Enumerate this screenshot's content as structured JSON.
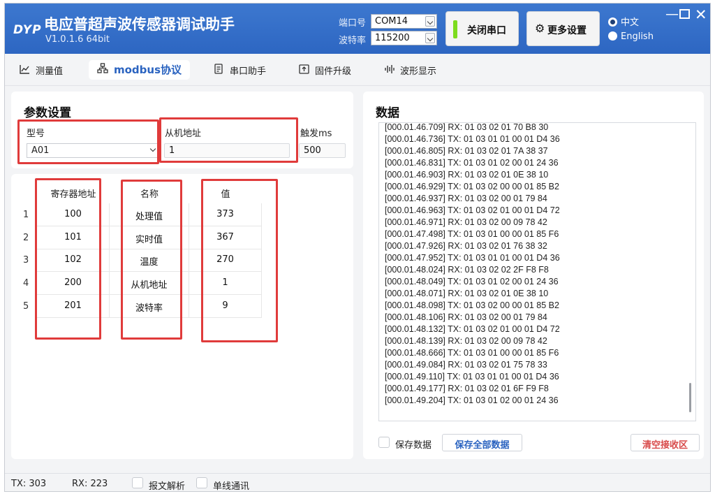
{
  "titlebar": {
    "logo": "DYP",
    "title": "电应普超声波传感器调试助手",
    "version": "V1.0.1.6 64bit",
    "port_label": "端口号",
    "port_value": "COM14",
    "baud_label": "波特率",
    "baud_value": "115200",
    "close_port": "关闭串口",
    "more_settings": "更多设置",
    "lang_zh": "中文",
    "lang_en": "English",
    "selected_language": "中文",
    "connected_indicator_color": "#7ddc1f",
    "bar_color": "#2d66c2"
  },
  "tabs": [
    {
      "label": "测量值",
      "icon": "chart-line-icon"
    },
    {
      "label": "modbus协议",
      "icon": "network-icon",
      "active": true
    },
    {
      "label": "串口助手",
      "icon": "document-icon"
    },
    {
      "label": "固件升级",
      "icon": "upload-icon"
    },
    {
      "label": "波形显示",
      "icon": "waveform-icon"
    }
  ],
  "params": {
    "title": "参数设置",
    "model_label": "型号",
    "model_value": "A01",
    "slave_label": "从机地址",
    "slave_value": "1",
    "trigger_label": "触发ms",
    "trigger_value": "500"
  },
  "register_table": {
    "headers": [
      "寄存器地址",
      "名称",
      "值"
    ],
    "rows": [
      {
        "n": "1",
        "addr": "100",
        "name": "处理值",
        "value": "373"
      },
      {
        "n": "2",
        "addr": "101",
        "name": "实时值",
        "value": "367"
      },
      {
        "n": "3",
        "addr": "102",
        "name": "温度",
        "value": "270"
      },
      {
        "n": "4",
        "addr": "200",
        "name": "从机地址",
        "value": "1"
      },
      {
        "n": "5",
        "addr": "201",
        "name": "波特率",
        "value": "9"
      }
    ]
  },
  "data": {
    "title": "数据",
    "log": [
      "[000.01.46.709] RX: 01 03 02 01 70 B8 30",
      "[000.01.46.736] TX: 01 03 01 01 00 01 D4 36",
      "[000.01.46.805] RX: 01 03 02 01 7A 38 37",
      "[000.01.46.831] TX: 01 03 01 02 00 01 24 36",
      "[000.01.46.903] RX: 01 03 02 01 0E 38 10",
      "[000.01.46.929] TX: 01 03 02 00 00 01 85 B2",
      "[000.01.46.937] RX: 01 03 02 00 01 79 84",
      "[000.01.46.963] TX: 01 03 02 01 00 01 D4 72",
      "[000.01.46.971] RX: 01 03 02 00 09 78 42",
      "[000.01.47.498] TX: 01 03 01 00 00 01 85 F6",
      "[000.01.47.926] RX: 01 03 02 01 76 38 32",
      "[000.01.47.952] TX: 01 03 01 01 00 01 D4 36",
      "[000.01.48.024] RX: 01 03 02 02 2F F8 F8",
      "[000.01.48.049] TX: 01 03 01 02 00 01 24 36",
      "[000.01.48.071] RX: 01 03 02 01 0E 38 10",
      "[000.01.48.098] TX: 01 03 02 00 00 01 85 B2",
      "[000.01.48.106] RX: 01 03 02 00 01 79 84",
      "[000.01.48.132] TX: 01 03 02 01 00 01 D4 72",
      "[000.01.48.139] RX: 01 03 02 00 09 78 42",
      "[000.01.48.666] TX: 01 03 01 00 00 01 85 F6",
      "[000.01.49.084] RX: 01 03 02 01 75 78 33",
      "[000.01.49.110] TX: 01 03 01 01 00 01 D4 36",
      "[000.01.49.177] RX: 01 03 02 01 6F F9 F8",
      "[000.01.49.204] TX: 01 03 01 02 00 01 24 36"
    ],
    "save_data_label": "保存数据",
    "save_all_label": "保存全部数据",
    "clear_rx_label": "清空接收区"
  },
  "status": {
    "tx": "TX: 303",
    "rx": "RX: 223",
    "parse_label": "报文解析",
    "single_wire_label": "单线通讯"
  }
}
